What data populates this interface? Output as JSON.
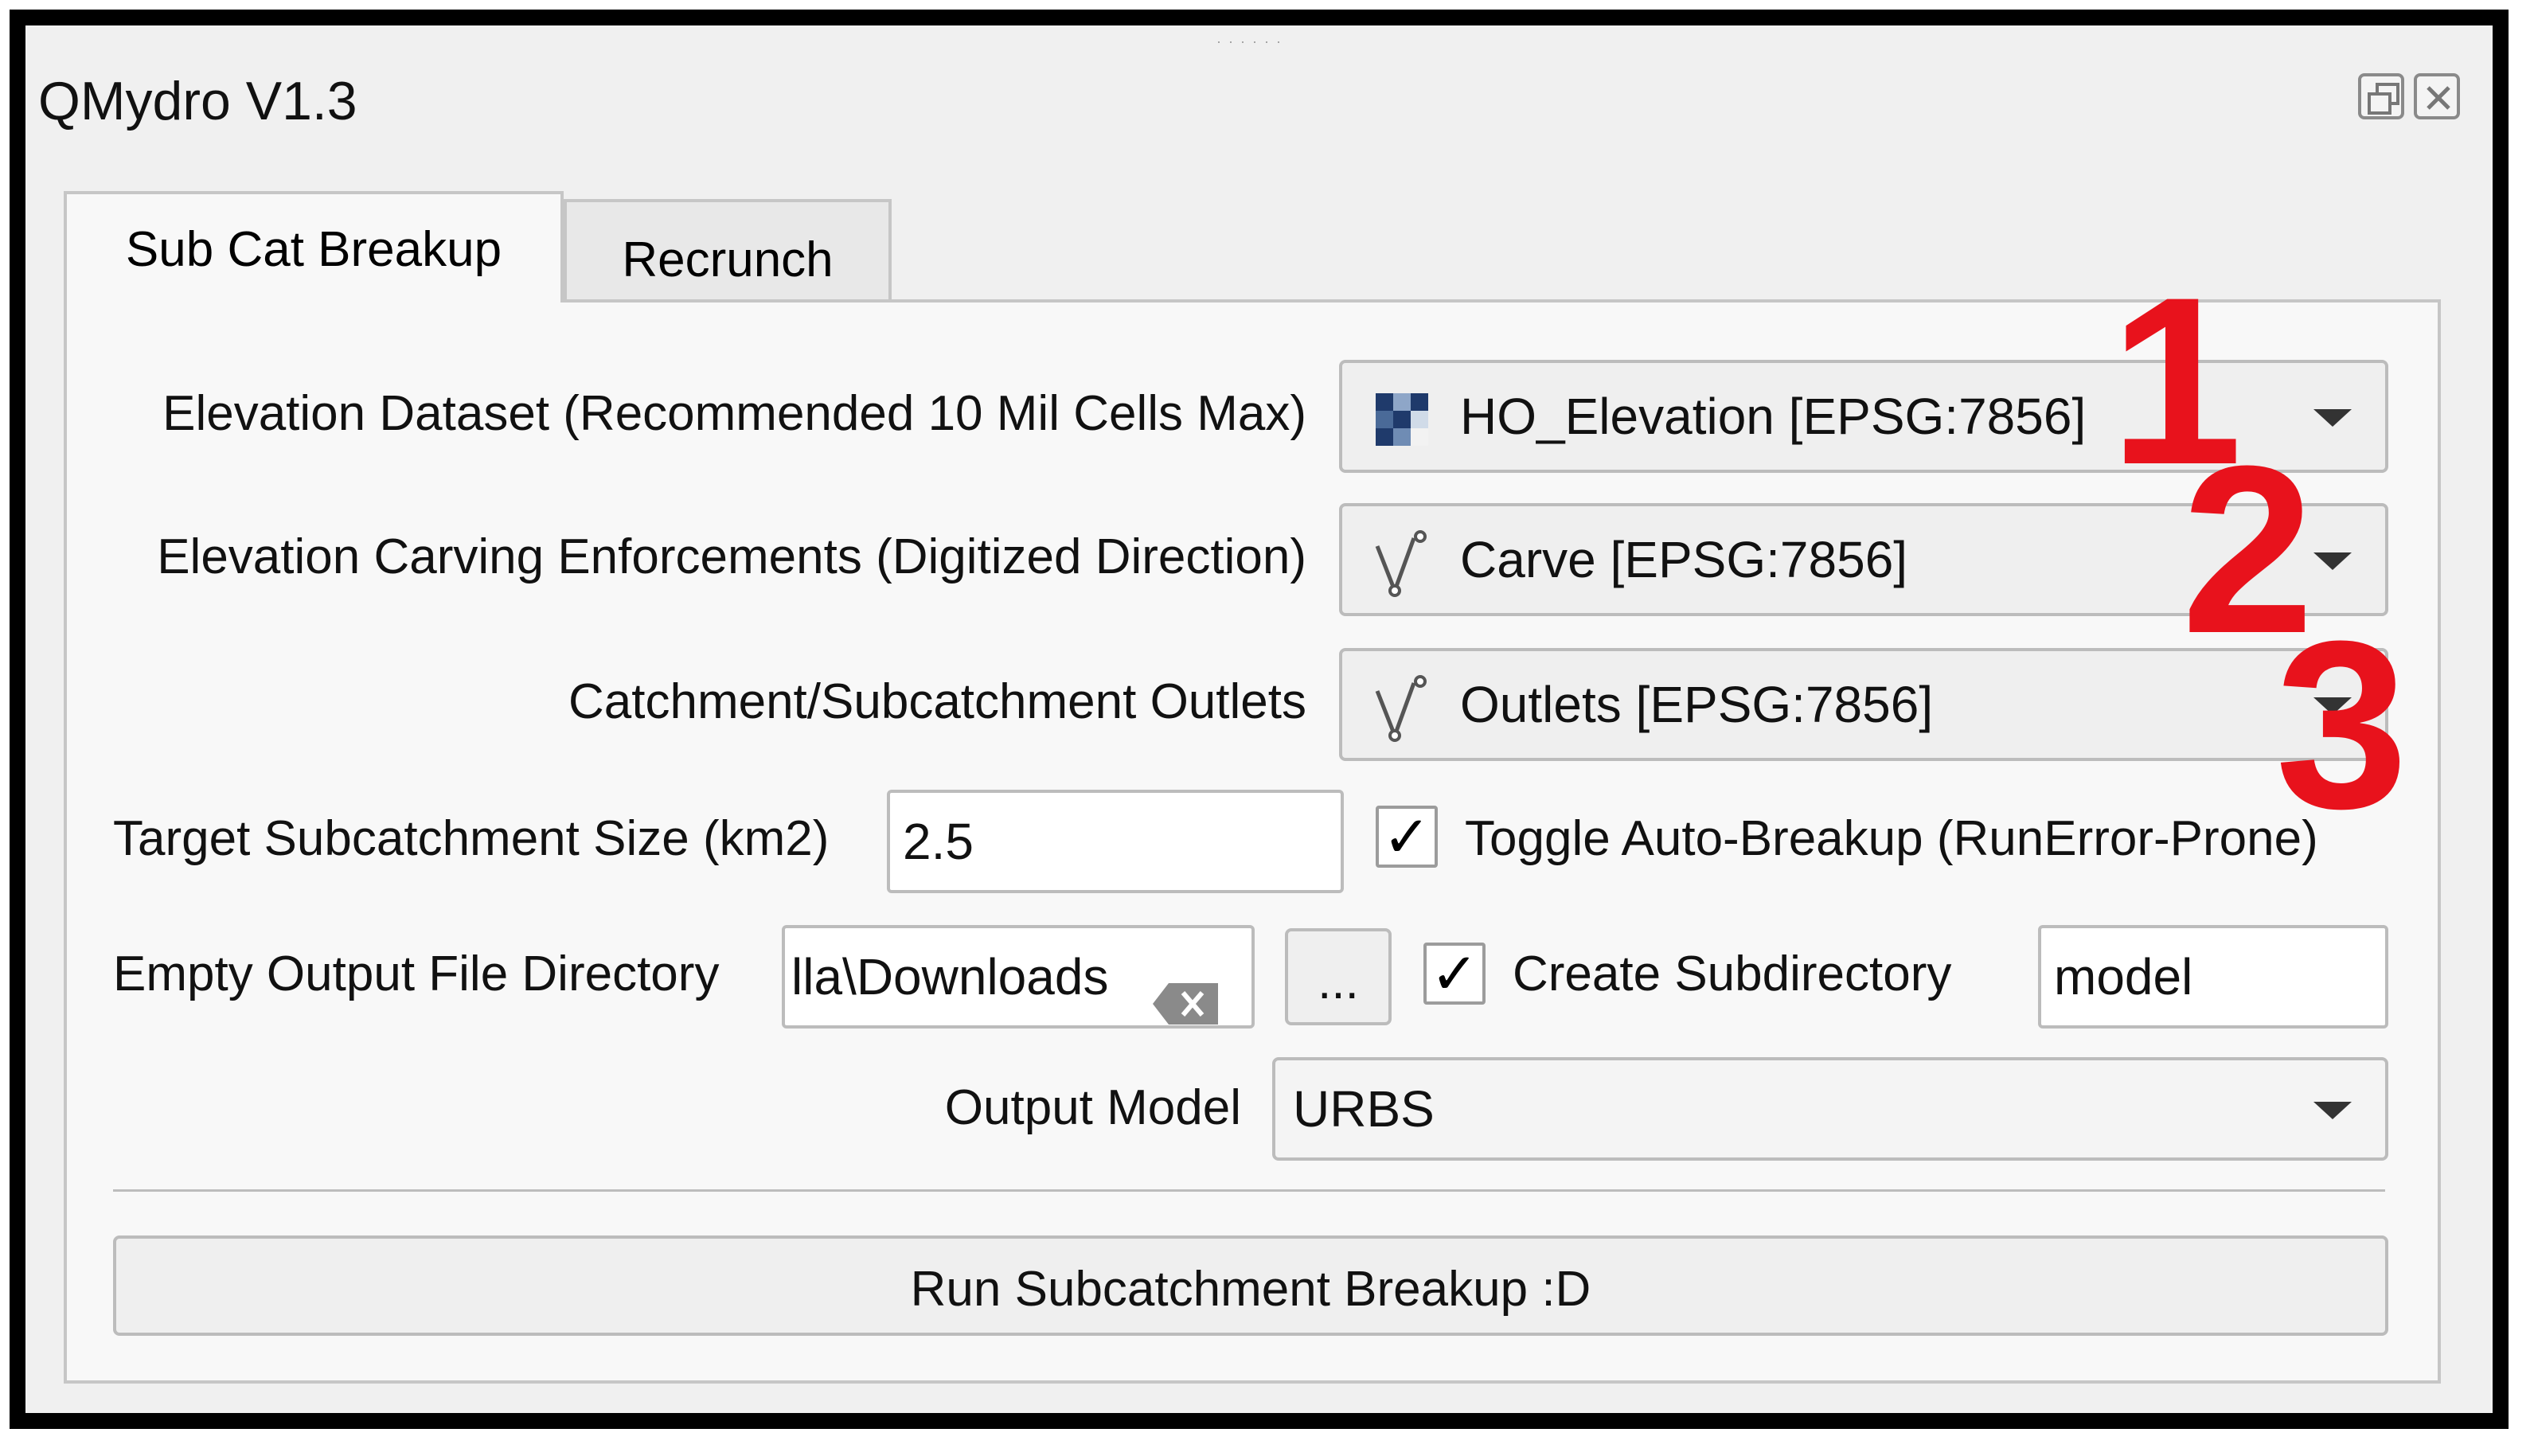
{
  "window": {
    "title": "QMydro V1.3",
    "restore_icon": "restore-window-icon",
    "close_icon": "close-window-icon"
  },
  "tabs": [
    {
      "label": "Sub Cat Breakup",
      "active": true
    },
    {
      "label": "Recrunch",
      "active": false
    }
  ],
  "form": {
    "elevation": {
      "label": "Elevation Dataset (Recommended 10 Mil Cells Max)",
      "value": "HO_Elevation [EPSG:7856]",
      "icon": "raster-layer-icon"
    },
    "carving": {
      "label": "Elevation Carving Enforcements (Digitized Direction)",
      "value": "Carve [EPSG:7856]",
      "icon": "line-layer-icon"
    },
    "outlets": {
      "label": "Catchment/Subcatchment Outlets",
      "value": "Outlets [EPSG:7856]",
      "icon": "line-layer-icon"
    },
    "target_size": {
      "label": "Target Subcatchment Size (km2)",
      "value": "2.5"
    },
    "auto_breakup": {
      "label": "Toggle Auto-Breakup (RunError-Prone)",
      "checked": true
    },
    "output_dir": {
      "label": "Empty Output File Directory",
      "value": "lla\\Downloads",
      "browse_label": "..."
    },
    "create_subdir": {
      "label": "Create Subdirectory",
      "checked": true,
      "value": "model"
    },
    "output_model": {
      "label": "Output Model",
      "value": "URBS"
    },
    "run_button": "Run Subcatchment Breakup :D"
  },
  "annotations": [
    "1",
    "2",
    "3"
  ],
  "colors": {
    "annotation": "#e8121c",
    "panel": "#f8f8f8",
    "frame": "#000000"
  }
}
